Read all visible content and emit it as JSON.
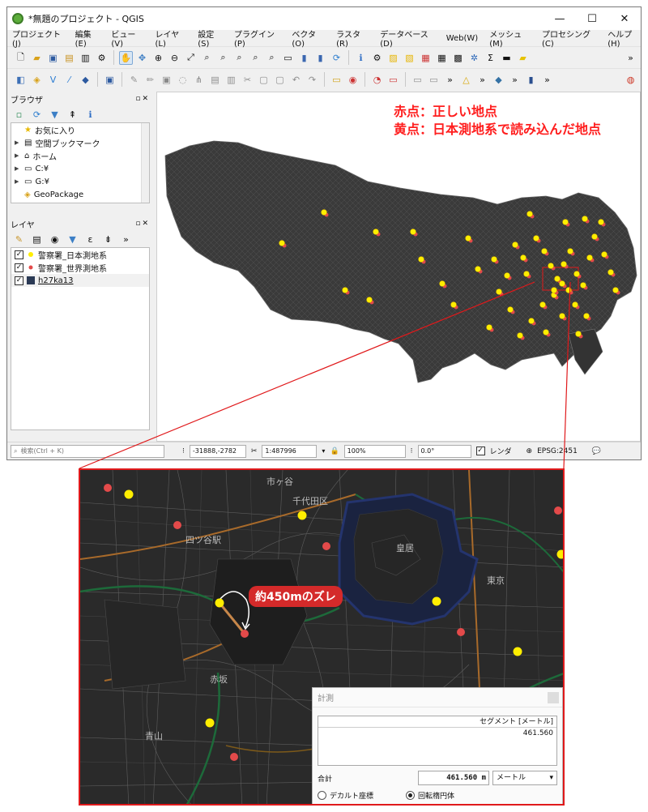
{
  "window": {
    "title": "*無題のプロジェクト - QGIS",
    "minimize": "—",
    "maximize": "☐",
    "close": "✕"
  },
  "menu": [
    "プロジェクト(J)",
    "編集(E)",
    "ビュー(V)",
    "レイヤ(L)",
    "設定(S)",
    "プラグイン(P)",
    "ベクタ(O)",
    "ラスタ(R)",
    "データベース(D)",
    "Web(W)",
    "メッシュ(M)",
    "プロセシング(C)",
    "ヘルプ(H)"
  ],
  "browser": {
    "title": "ブラウザ",
    "items": [
      {
        "label": "お気に入り",
        "icon": "star-icon"
      },
      {
        "label": "空間ブックマーク",
        "icon": "bookmark-icon"
      },
      {
        "label": "ホーム",
        "icon": "home-icon"
      },
      {
        "label": "C:¥",
        "icon": "folder-icon"
      },
      {
        "label": "G:¥",
        "icon": "folder-icon"
      },
      {
        "label": "GeoPackage",
        "icon": "geopackage-icon"
      }
    ]
  },
  "layers": {
    "title": "レイヤ",
    "items": [
      {
        "label": "警察署_日本測地系",
        "color": "#ffee00"
      },
      {
        "label": "警察署_世界測地系",
        "color": "#e34a4a"
      },
      {
        "label": "h27ka13",
        "color": "#2b3a55"
      }
    ]
  },
  "annotation": {
    "red": "赤点：正しい地点",
    "yellow": "黄点：日本測地系で読み込んだ地点"
  },
  "status": {
    "search_placeholder": "検索(Ctrl + K)",
    "coordinate": "-31888,-2782",
    "scale": "1:487996",
    "magnifier": "100%",
    "rotation": "0.0°",
    "render_label": "レンダ",
    "crs": "EPSG:2451"
  },
  "zoom": {
    "callout": "約450mのズレ",
    "labels": {
      "chiyoda": "千代田区",
      "kokyo": "皇居",
      "yotsuya": "四ツ谷駅",
      "akasaka": "赤坂",
      "aoyama": "青山",
      "ichigaya": "市ヶ谷",
      "tokyo": "東京"
    }
  },
  "measure": {
    "title": "計測",
    "column": "セグメント [メートル]",
    "segment": "461.560",
    "total_label": "合計",
    "total_value": "461.560 m",
    "unit": "メートル",
    "cartesian": "デカルト座標",
    "ellipsoidal": "回転楕円体"
  }
}
